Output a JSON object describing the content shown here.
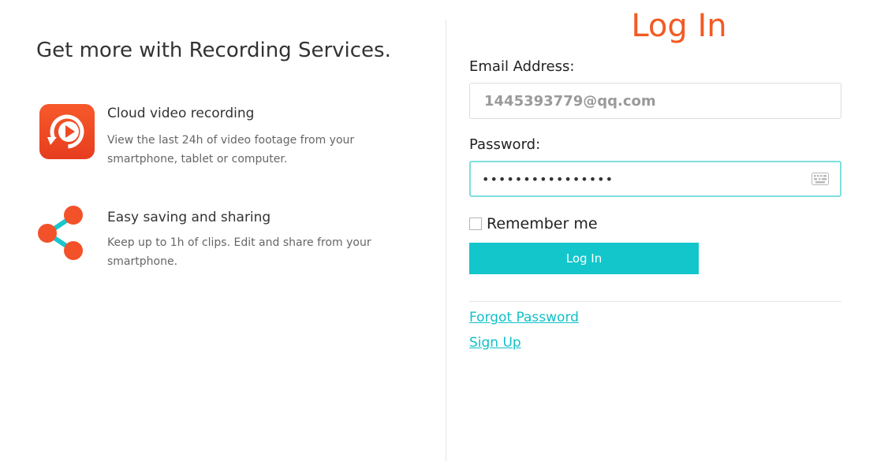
{
  "intro": {
    "headline": "Get more with Recording Services.",
    "features": [
      {
        "icon": "cloud-recording-icon",
        "title": "Cloud video recording",
        "description": "View the last 24h of video footage from your smartphone, tablet or computer."
      },
      {
        "icon": "share-icon",
        "title": "Easy saving and sharing",
        "description": "Keep up to 1h of clips. Edit and share from your smartphone."
      }
    ]
  },
  "login": {
    "title": "Log In",
    "email_label": "Email Address:",
    "email_value": "1445393779@qq.com",
    "password_label": "Password:",
    "password_value": "••••••••••••••••",
    "remember_label": "Remember me",
    "remember_checked": false,
    "button_label": "Log In",
    "forgot_label": "Forgot Password",
    "signup_label": "Sign Up"
  },
  "colors": {
    "accent": "#f25a23",
    "brand_teal": "#12c6cb",
    "input_focus_border": "#7fdedd"
  }
}
